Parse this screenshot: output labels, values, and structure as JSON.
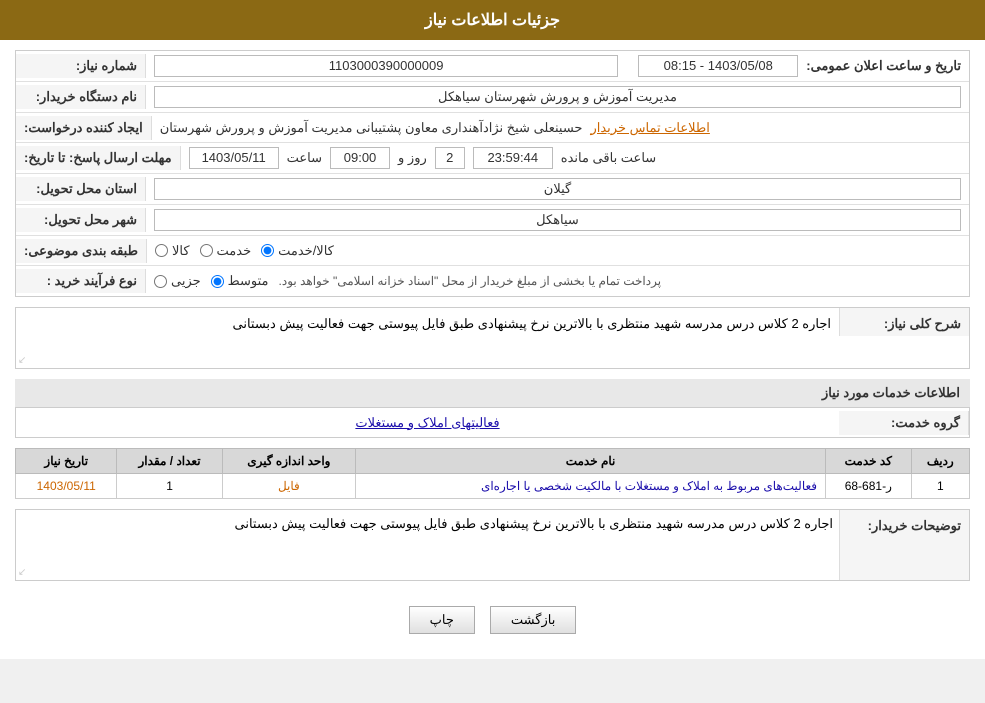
{
  "header": {
    "title": "جزئیات اطلاعات نیاز"
  },
  "fields": {
    "shmare_niaz_label": "شماره نیاز:",
    "shmare_niaz_value": "1103000390000009",
    "name_dastgah_label": "نام دستگاه خریدار:",
    "name_dastgah_value": "مدیریت آموزش و پرورش شهرستان سیاهکل",
    "ejad_label": "ایجاد کننده درخواست:",
    "ejad_value": "حسینعلی شیخ نژادآهنداری معاون پشتیبانی مدیریت آموزش و پرورش شهرستان",
    "ejad_link": "اطلاعات تماس خریدار",
    "mohlet_label": "مهلت ارسال پاسخ: تا تاریخ:",
    "tarikh_value": "1403/05/11",
    "saat_label": "ساعت",
    "saat_value": "09:00",
    "roz_label": "روز و",
    "roz_value": "2",
    "mande_label": "ساعت باقی مانده",
    "mande_value": "23:59:44",
    "tarikh_elam_label": "تاریخ و ساعت اعلان عمومی:",
    "tarikh_elam_value": "1403/05/08 - 08:15",
    "ostan_label": "استان محل تحویل:",
    "ostan_value": "گیلان",
    "shahr_label": "شهر محل تحویل:",
    "shahr_value": "سیاهکل",
    "tabaqe_label": "طبقه بندی موضوعی:",
    "tabaqe_kala": "کالا",
    "tabaqe_khadmat": "خدمت",
    "tabaqe_kala_khadmat": "کالا/خدمت",
    "noac_label": "نوع فرآیند خرید :",
    "noac_jazii": "جزیی",
    "noac_motovaset": "متوسط",
    "noac_desc": "پرداخت تمام یا بخشی از مبلغ خریدار از محل \"اسناد خزانه اسلامی\" خواهد بود.",
    "sharh_label": "شرح کلی نیاز:",
    "sharh_value": "اجاره 2 کلاس درس مدرسه شهید منتظری با بالاترین نرخ پیشنهادی طبق فایل پیوستی جهت فعالیت پیش دبستانی",
    "khadamat_title": "اطلاعات خدمات مورد نیاز",
    "goroh_label": "گروه خدمت:",
    "goroh_value": "فعالیتهای املاک و مستغلات",
    "table": {
      "headers": [
        "ردیف",
        "کد خدمت",
        "نام خدمت",
        "واحد اندازه گیری",
        "تعداد / مقدار",
        "تاریخ نیاز"
      ],
      "rows": [
        {
          "radif": "1",
          "kod": "ر-681-68",
          "name": "فعالیت‌های مربوط به املاک و مستغلات با مالکیت شخصی یا اجاره‌ای",
          "vahed": "فایل",
          "tedad": "1",
          "tarikh": "1403/05/11"
        }
      ]
    },
    "tozi_label": "توضیحات خریدار:",
    "tozi_value": "اجاره 2 کلاس درس مدرسه شهید منتظری با بالاترین نرخ پیشنهادی طبق فایل پیوستی جهت فعالیت پیش دبستانی",
    "btn_chap": "چاپ",
    "btn_bazgasht": "بازگشت"
  }
}
